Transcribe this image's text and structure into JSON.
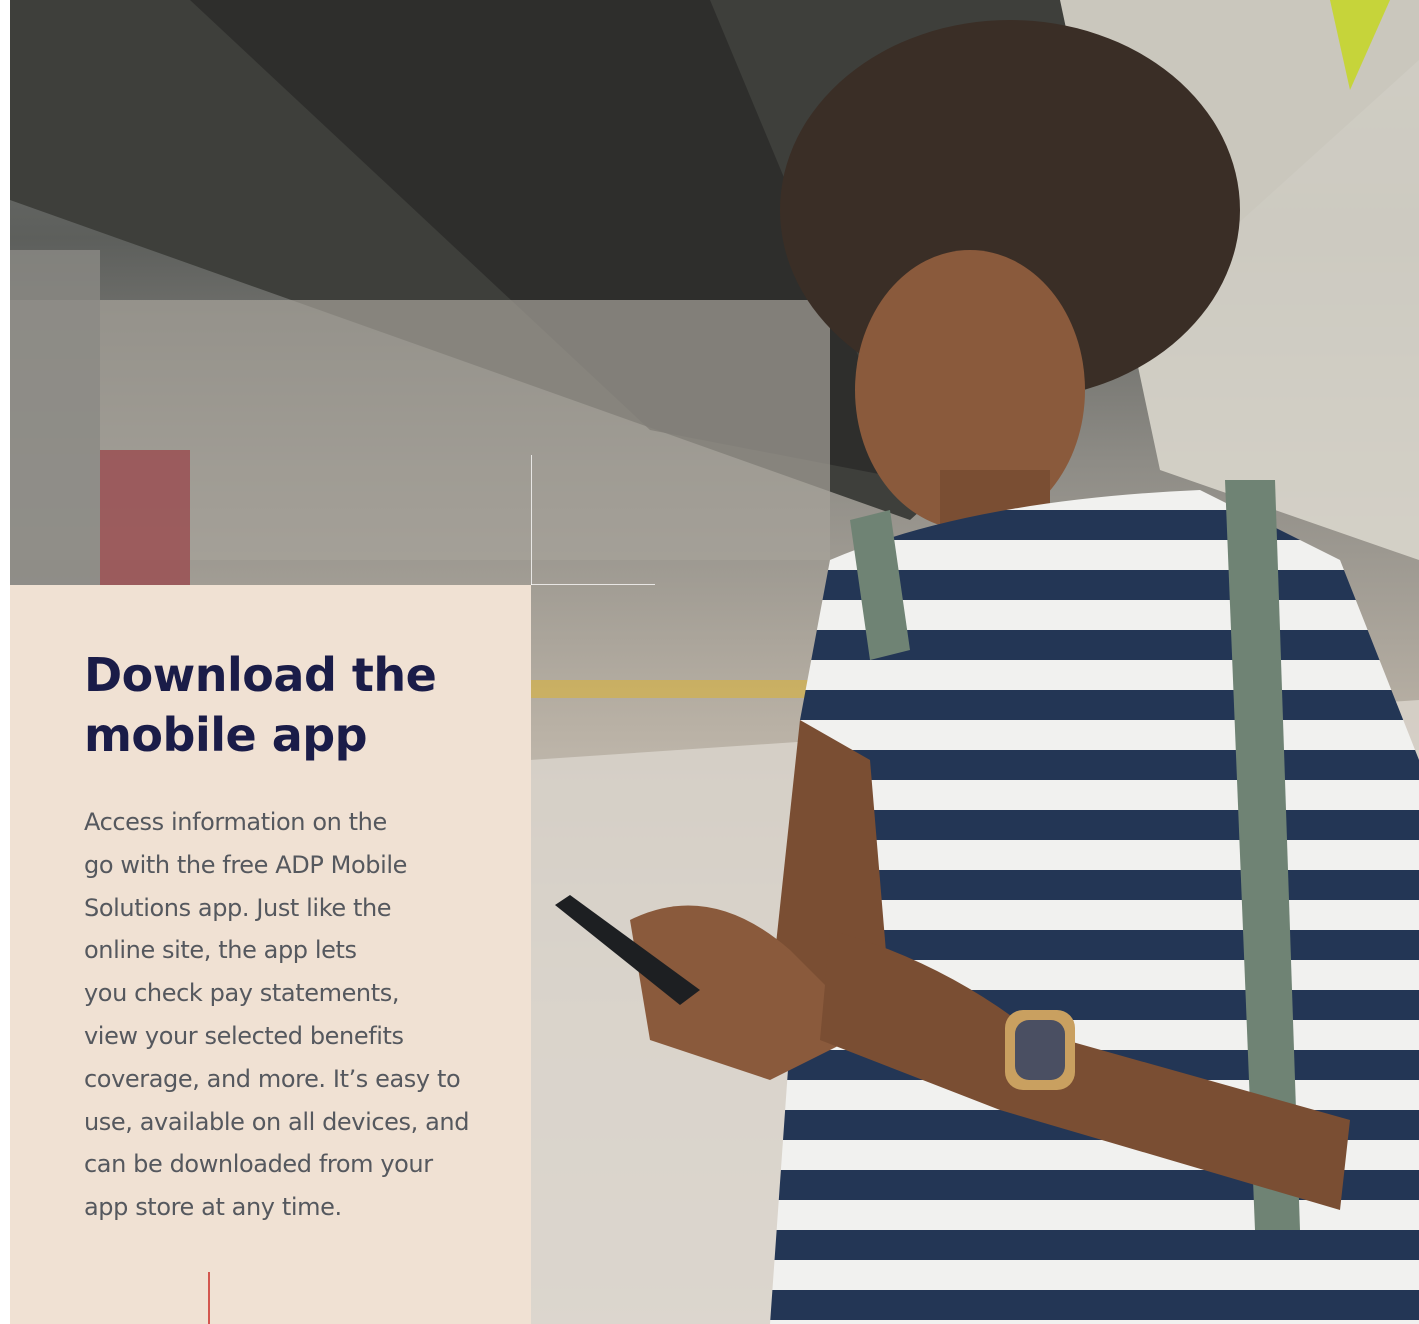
{
  "article": {
    "title_line1": "Download the",
    "title_line2": "mobile app",
    "body_lines": [
      "Access information on the",
      "go with the free ADP Mobile",
      "Solutions app. Just like the",
      "online site, the app lets",
      "you check pay statements,",
      "view your selected benefits",
      "coverage, and more. It’s easy to",
      "use, available on all devices, and",
      "can be downloaded from your",
      "app store at any time."
    ]
  },
  "colors": {
    "card_background": "#f0e1d3",
    "title": "#1a1c48",
    "body_text": "#55585e",
    "accent": "#d3574f"
  },
  "photo": {
    "subject": "man-using-phone-icon"
  }
}
